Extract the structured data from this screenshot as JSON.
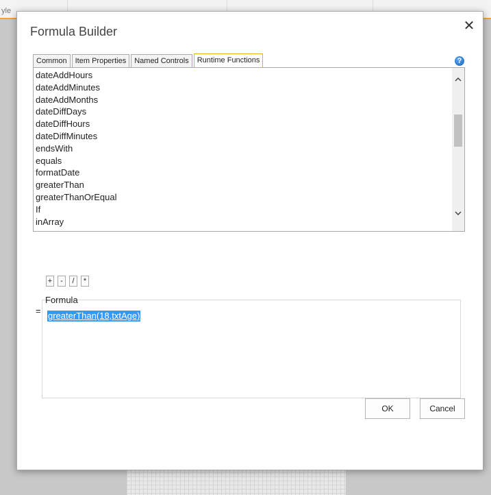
{
  "background": {
    "header_fragment": "yle"
  },
  "dialog": {
    "title": "Formula Builder",
    "close_glyph": "✕",
    "help_glyph": "?",
    "tabs": [
      {
        "label": "Common",
        "active": false
      },
      {
        "label": "Item Properties",
        "active": false
      },
      {
        "label": "Named Controls",
        "active": false
      },
      {
        "label": "Runtime Functions",
        "active": true
      }
    ],
    "functions": [
      "dateAddHours",
      "dateAddMinutes",
      "dateAddMonths",
      "dateDiffDays",
      "dateDiffHours",
      "dateDiffMinutes",
      "endsWith",
      "equals",
      "formatDate",
      "greaterThan",
      "greaterThanOrEqual",
      "If",
      "inArray"
    ],
    "operators": [
      "+",
      "-",
      "/",
      "*"
    ],
    "equals_sign": "=",
    "formula_label": "Formula",
    "formula_value": "greaterThan(18,txtAge)",
    "ok_label": "OK",
    "cancel_label": "Cancel"
  },
  "colors": {
    "selection": "#3399ff",
    "active_tab_border": "#e0b020",
    "header_accent": "#f2a33a"
  }
}
